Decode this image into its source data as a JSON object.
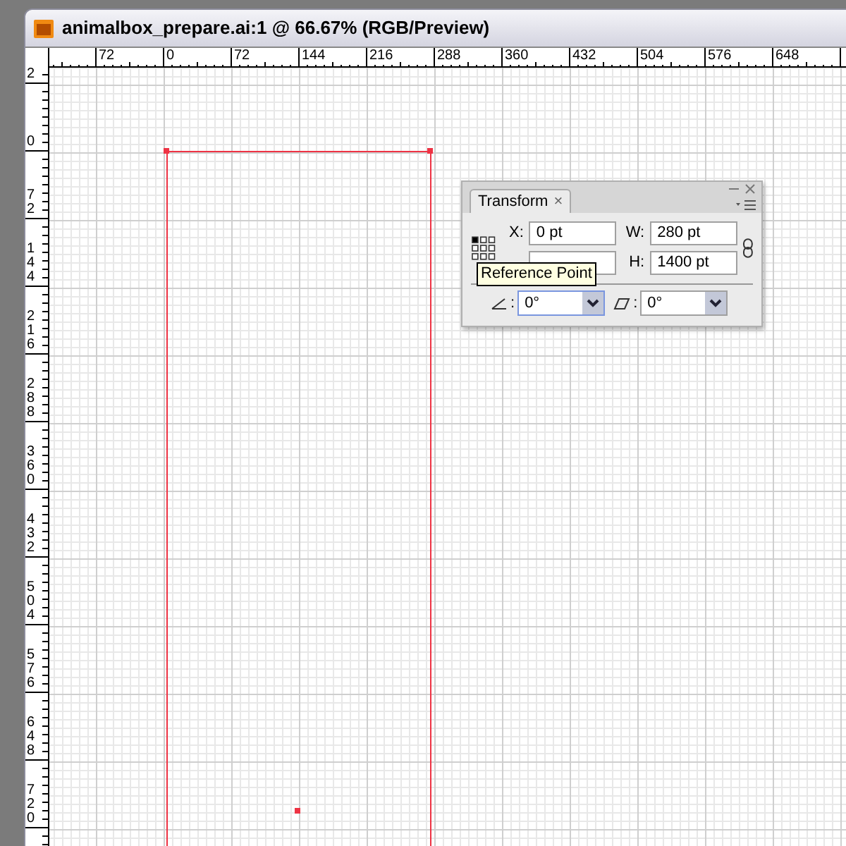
{
  "window": {
    "title": "animalbox_prepare.ai:1 @ 66.67% (RGB/Preview)"
  },
  "horizontal_ruler": {
    "labels": [
      "72",
      "0",
      "72",
      "144",
      "216",
      "288",
      "360",
      "432",
      "504",
      "576",
      "648"
    ]
  },
  "vertical_ruler": {
    "labels": [
      "2",
      "0",
      "72",
      "144",
      "216",
      "288",
      "360",
      "432",
      "504",
      "576",
      "648",
      "720"
    ]
  },
  "transform_panel": {
    "tab": {
      "label": "Transform",
      "close": "×"
    },
    "fields": [
      {
        "label": "X:",
        "value": "0 pt"
      },
      {
        "label": "W:",
        "value": "280 pt"
      },
      {
        "label": "H:",
        "value": "1400 pt"
      }
    ],
    "tooltip": "Reference Point",
    "selects": [
      {
        "kind": "rotate",
        "label": ":",
        "value": "0°",
        "focused": true
      },
      {
        "kind": "shear",
        "label": ":",
        "value": "0°",
        "focused": false
      }
    ]
  }
}
